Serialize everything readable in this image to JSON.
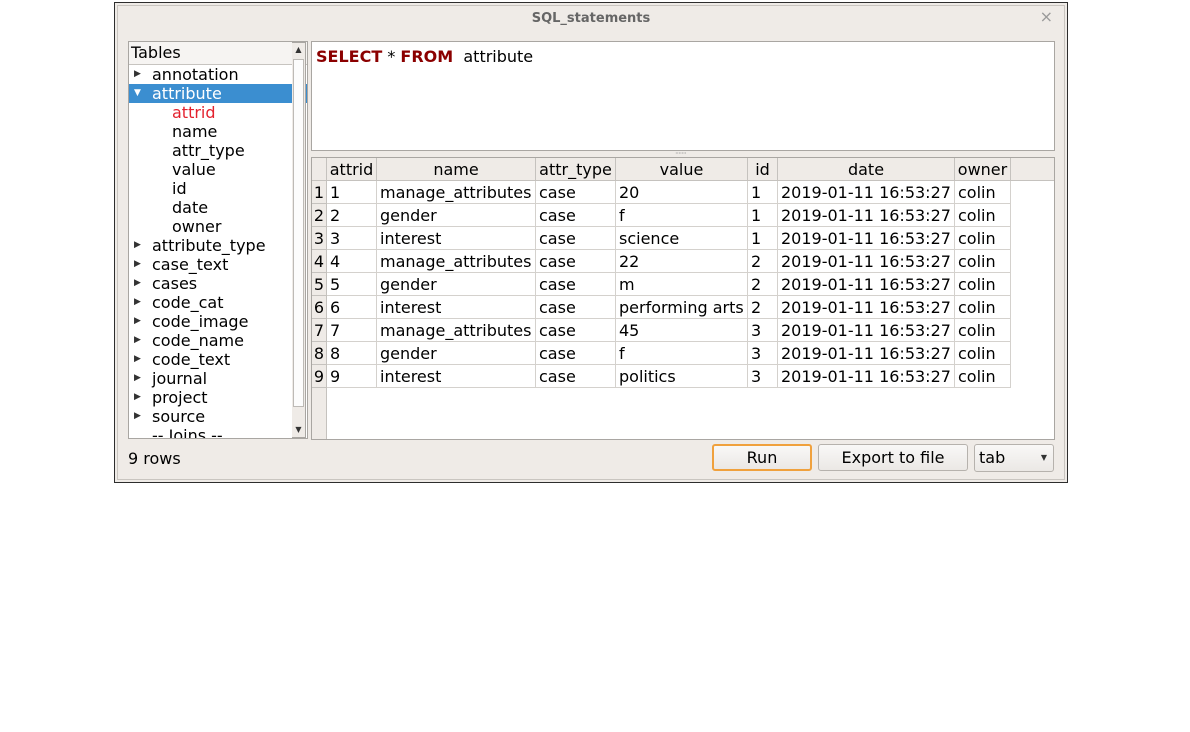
{
  "window": {
    "title": "SQL_statements",
    "close_glyph": "×"
  },
  "tree": {
    "header": "Tables",
    "items": [
      {
        "label": "annotation",
        "type": "table",
        "expanded": false
      },
      {
        "label": "attribute",
        "type": "table",
        "expanded": true,
        "selected": true
      },
      {
        "label": "attrid",
        "type": "column",
        "current": true
      },
      {
        "label": "name",
        "type": "column"
      },
      {
        "label": "attr_type",
        "type": "column"
      },
      {
        "label": "value",
        "type": "column"
      },
      {
        "label": "id",
        "type": "column"
      },
      {
        "label": "date",
        "type": "column"
      },
      {
        "label": "owner",
        "type": "column"
      },
      {
        "label": "attribute_type",
        "type": "table",
        "expanded": false
      },
      {
        "label": "case_text",
        "type": "table",
        "expanded": false
      },
      {
        "label": "cases",
        "type": "table",
        "expanded": false
      },
      {
        "label": "code_cat",
        "type": "table",
        "expanded": false
      },
      {
        "label": "code_image",
        "type": "table",
        "expanded": false
      },
      {
        "label": "code_name",
        "type": "table",
        "expanded": false
      },
      {
        "label": "code_text",
        "type": "table",
        "expanded": false
      },
      {
        "label": "journal",
        "type": "table",
        "expanded": false
      },
      {
        "label": "project",
        "type": "table",
        "expanded": false
      },
      {
        "label": "source",
        "type": "table",
        "expanded": false
      },
      {
        "label": "-- Joins --",
        "type": "separator"
      }
    ]
  },
  "editor": {
    "kw_select": "SELECT",
    "star": " * ",
    "kw_from": "FROM",
    "table": "  attribute"
  },
  "grid": {
    "columns": [
      "attrid",
      "name",
      "attr_type",
      "value",
      "id",
      "date",
      "owner"
    ],
    "rows": [
      [
        "1",
        "manage_attributes",
        "case",
        "20",
        "1",
        "2019-01-11 16:53:27",
        "colin"
      ],
      [
        "2",
        "gender",
        "case",
        "f",
        "1",
        "2019-01-11 16:53:27",
        "colin"
      ],
      [
        "3",
        "interest",
        "case",
        "science",
        "1",
        "2019-01-11 16:53:27",
        "colin"
      ],
      [
        "4",
        "manage_attributes",
        "case",
        "22",
        "2",
        "2019-01-11 16:53:27",
        "colin"
      ],
      [
        "5",
        "gender",
        "case",
        "m",
        "2",
        "2019-01-11 16:53:27",
        "colin"
      ],
      [
        "6",
        "interest",
        "case",
        "performing arts",
        "2",
        "2019-01-11 16:53:27",
        "colin"
      ],
      [
        "7",
        "manage_attributes",
        "case",
        "45",
        "3",
        "2019-01-11 16:53:27",
        "colin"
      ],
      [
        "8",
        "gender",
        "case",
        "f",
        "3",
        "2019-01-11 16:53:27",
        "colin"
      ],
      [
        "9",
        "interest",
        "case",
        "politics",
        "3",
        "2019-01-11 16:53:27",
        "colin"
      ]
    ],
    "row_numbers": [
      "1",
      "2",
      "3",
      "4",
      "5",
      "6",
      "7",
      "8",
      "9"
    ]
  },
  "status": {
    "row_count": "9 rows"
  },
  "buttons": {
    "run": "Run",
    "export": "Export to file"
  },
  "delimiter": {
    "selected": "tab"
  },
  "colors": {
    "keyword": "#8b0000",
    "selection": "#3b8ed0",
    "current_column": "#e3222e",
    "run_focus": "#f0a13d",
    "window_bg": "#efebe7"
  },
  "icons": {
    "collapsed": "triangle-right-icon",
    "expanded": "triangle-down-icon",
    "close": "close-icon",
    "dropdown": "chevron-down-icon"
  }
}
